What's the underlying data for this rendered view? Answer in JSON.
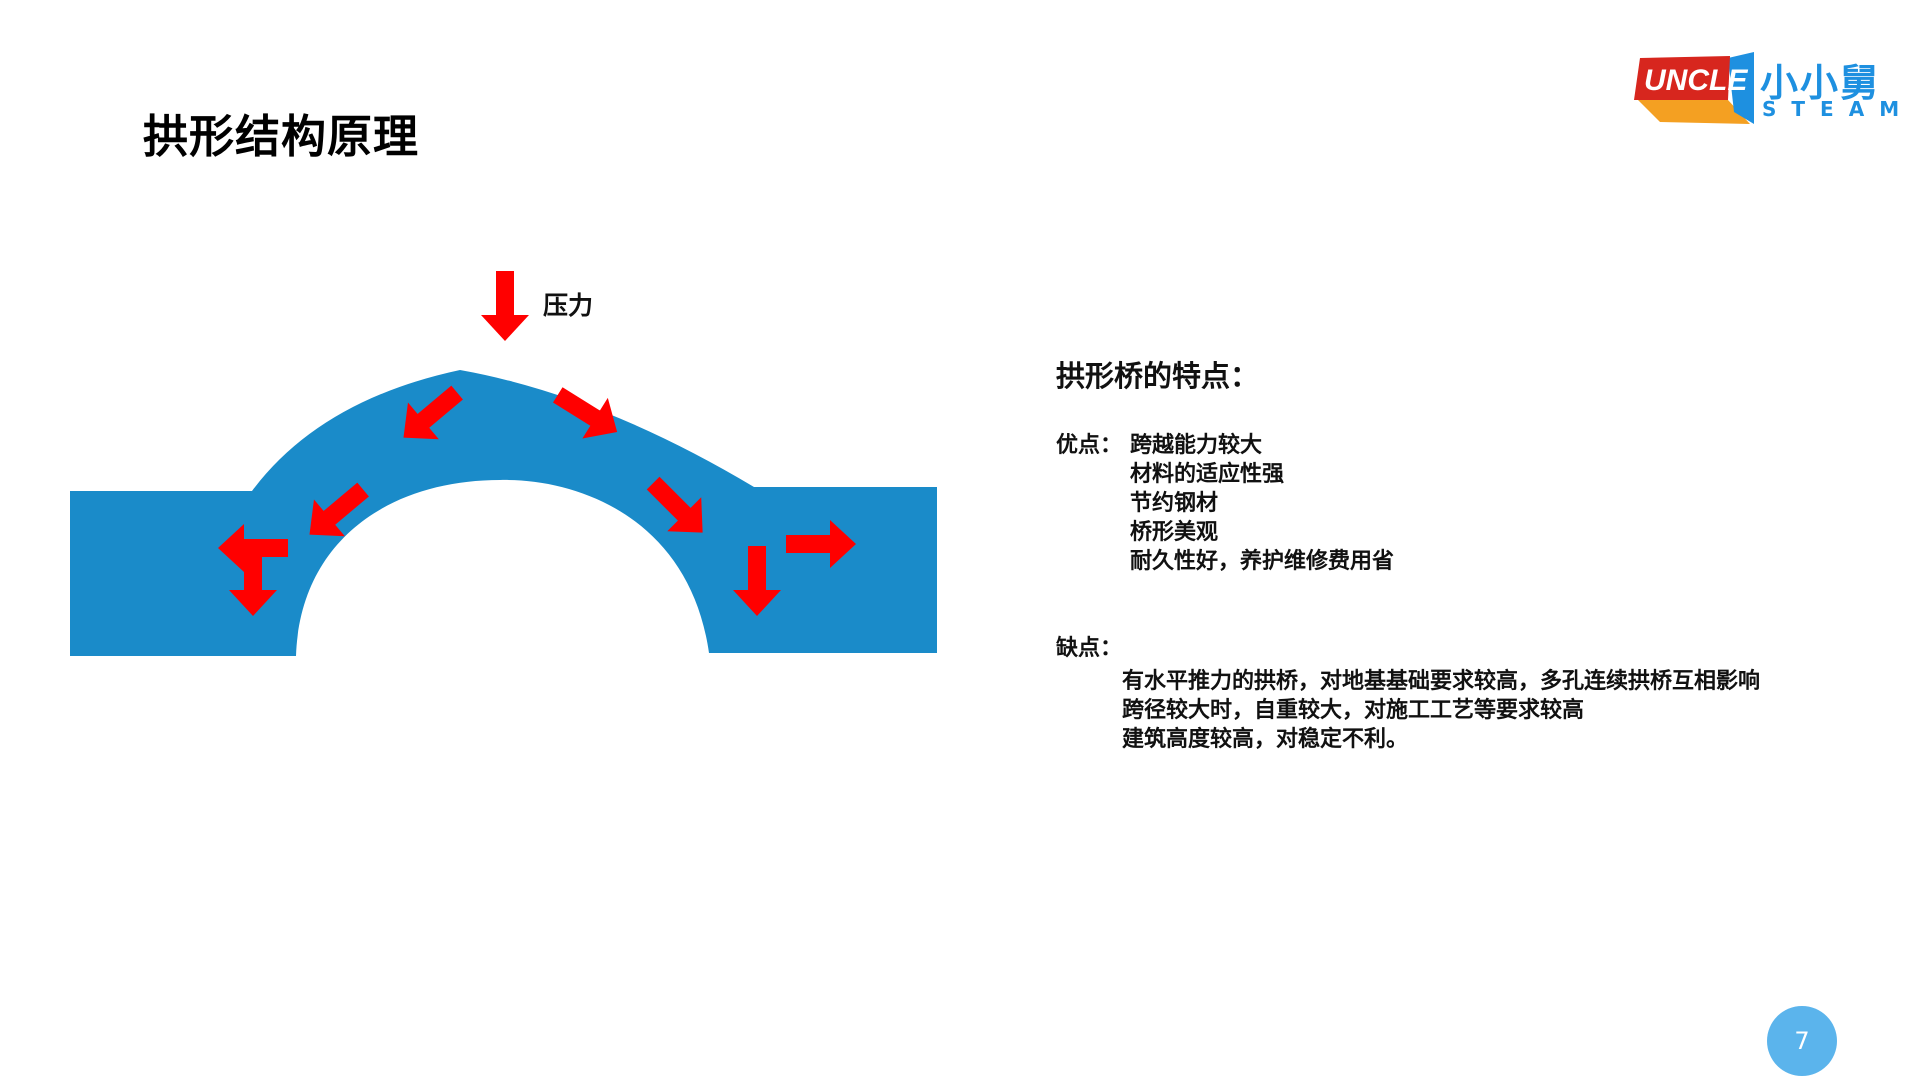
{
  "slide": {
    "title": "拱形结构原理",
    "page_number": "7"
  },
  "logo": {
    "badge_text": "UNCLE",
    "cn_text": "小小舅",
    "en_text": "STEAM",
    "colors": {
      "badge_red": "#d7261e",
      "badge_orange": "#f4a022",
      "badge_blue": "#1e90e0"
    }
  },
  "diagram": {
    "pressure_label": "压力",
    "colors": {
      "structure": "#1a8bc9",
      "arrow": "#ff0000"
    },
    "icons": [
      "arrow-down-icon",
      "arrow-down-left-icon",
      "arrow-down-right-icon",
      "arrow-left-icon",
      "arrow-right-icon"
    ]
  },
  "features": {
    "title": "拱形桥的特点：",
    "pros_label": "优点：",
    "pros": [
      "跨越能力较大",
      "材料的适应性强",
      "节约钢材",
      "桥形美观",
      "耐久性好，养护维修费用省"
    ],
    "cons_label": "缺点：",
    "cons": [
      "有水平推力的拱桥，对地基基础要求较高，多孔连续拱桥互相影响",
      "跨径较大时，自重较大，对施工工艺等要求较高",
      "建筑高度较高，对稳定不利。"
    ]
  }
}
